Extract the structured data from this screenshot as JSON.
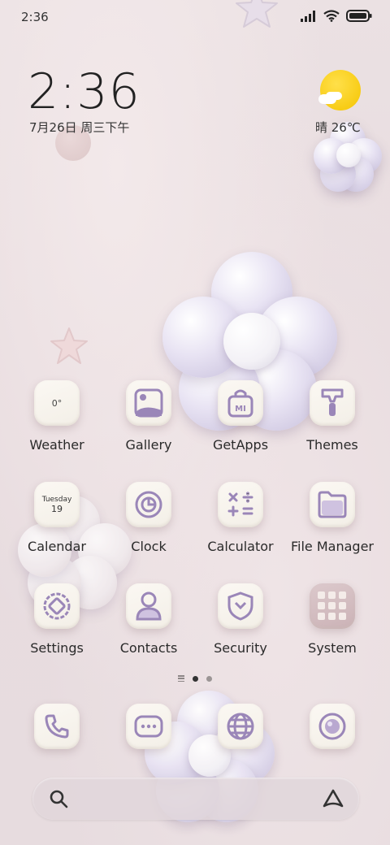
{
  "status_bar": {
    "time": "2:36"
  },
  "clock": {
    "time": "2:36",
    "date": "7月26日 周三下午"
  },
  "weather": {
    "text": "晴 26℃"
  },
  "apps": [
    {
      "label": "Weather",
      "icon": "weather-icon",
      "badge": "0°"
    },
    {
      "label": "Gallery",
      "icon": "gallery-icon"
    },
    {
      "label": "GetApps",
      "icon": "getapps-icon"
    },
    {
      "label": "Themes",
      "icon": "themes-icon"
    },
    {
      "label": "Calendar",
      "icon": "calendar-icon",
      "day": "Tuesday",
      "num": "19"
    },
    {
      "label": "Clock",
      "icon": "clock-icon"
    },
    {
      "label": "Calculator",
      "icon": "calculator-icon"
    },
    {
      "label": "File Manager",
      "icon": "file-manager-icon"
    },
    {
      "label": "Settings",
      "icon": "settings-icon"
    },
    {
      "label": "Contacts",
      "icon": "contacts-icon"
    },
    {
      "label": "Security",
      "icon": "security-icon"
    },
    {
      "label": "System",
      "icon": "system-folder-icon"
    }
  ],
  "dock": [
    {
      "icon": "phone-icon"
    },
    {
      "icon": "messages-icon"
    },
    {
      "icon": "browser-icon"
    },
    {
      "icon": "camera-icon"
    }
  ],
  "pages": {
    "count": 2,
    "active": 0
  },
  "colors": {
    "icon_purple": "#9a86b8",
    "tile_bg": "#f7f3ec",
    "sun": "#f7cc10"
  }
}
